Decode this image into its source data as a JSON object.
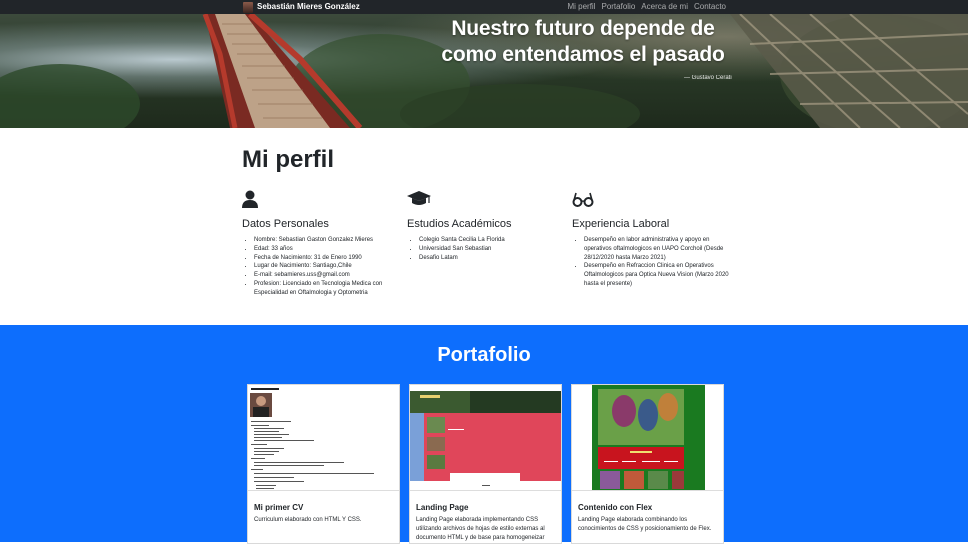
{
  "nav": {
    "brand": "Sebastián Mieres González",
    "links": [
      "Mi perfil",
      "Portafolio",
      "Acerca de mi",
      "Contacto"
    ]
  },
  "hero": {
    "title": "Nuestro futuro depende de como entendamos el pasado",
    "quote": "— Gustavo Cerati"
  },
  "perfil": {
    "title": "Mi perfil",
    "columns": [
      {
        "icon": "person-icon",
        "heading": "Datos Personales",
        "items": [
          "Nombre: Sebastian Gaston Gonzalez Mieres",
          "Edad: 33 años",
          "Fecha de Nacimiento: 31 de Enero 1990",
          "Lugar de Nacimiento: Santiago,Chile",
          "E-mail: sebamieres.uss@gmail.com",
          "Profesion: Licenciado en Tecnologia Medica con Especialidad en Oftalmologia y Optometria"
        ]
      },
      {
        "icon": "graduation-cap-icon",
        "heading": "Estudios Académicos",
        "items": [
          "Colegio Santa Cecilia La Florida",
          "Universidad San Sebastian",
          "Desafio Latam"
        ]
      },
      {
        "icon": "glasses-icon",
        "heading": "Experiencia Laboral",
        "items": [
          "Desempeño en labor administrativa y apoyo en operativos oftalmologicos en UAPO Corchoil (Desde 28/12/2020 hasta Marzo 2021)",
          "Desempeño en Refraccion Clinica en Operativos Oftalmologicos para Optica Nueva Vision (Marzo 2020 hasta el presente)"
        ]
      }
    ]
  },
  "portafolio": {
    "title": "Portafolio",
    "cards": [
      {
        "title": "Mi primer CV",
        "text": "Curriculum elaborado con HTML Y CSS."
      },
      {
        "title": "Landing Page",
        "text": "Landing Page elaborada implementando CSS utilizando archivos de hojas de estilo externas al documento HTML y de base para homogeneizar"
      },
      {
        "title": "Contenido con Flex",
        "text": "Landing Page elaborada combinando los conocimientos de CSS y posicionamiento de Flex."
      }
    ]
  },
  "colors": {
    "navbar": "#212529",
    "primary": "#0d6efd"
  }
}
